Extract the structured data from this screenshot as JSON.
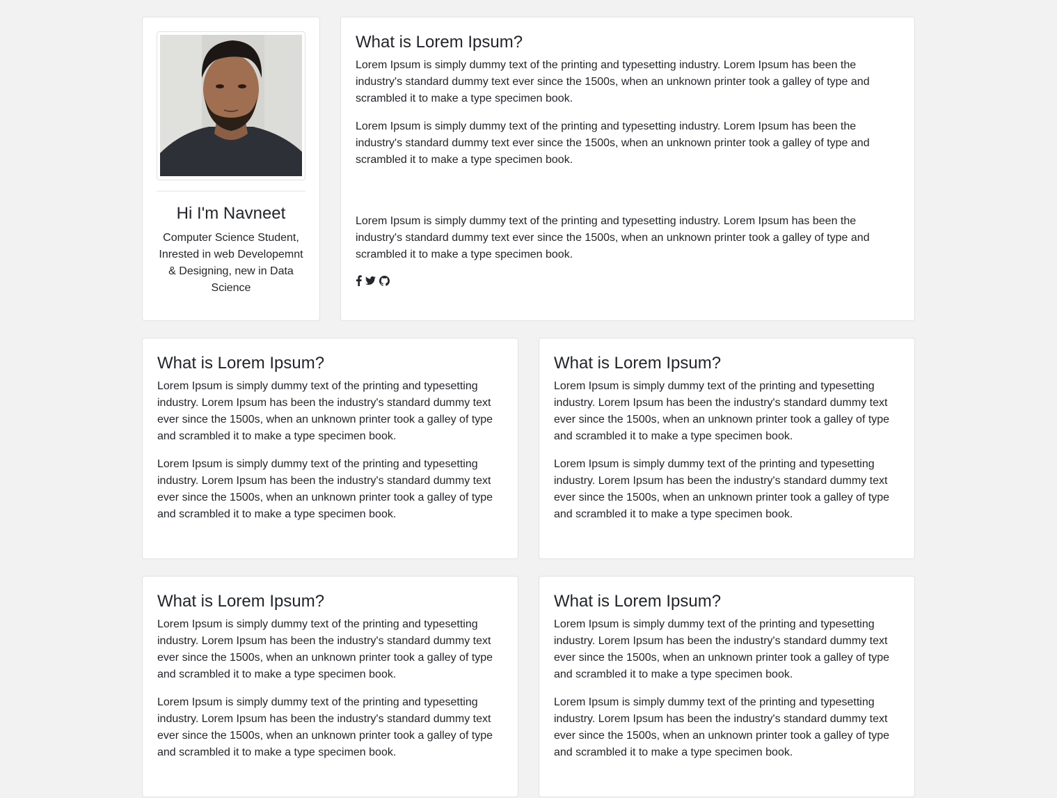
{
  "profile": {
    "name": "Hi I'm Navneet",
    "bio": "Computer Science Student, Inrested in web Developemnt & Designing, new in Data Science",
    "photo_alt": "profile photo"
  },
  "main": {
    "title": "What is Lorem Ipsum?",
    "paragraphs": [
      "Lorem Ipsum is simply dummy text of the printing and typesetting industry. Lorem Ipsum has been the industry's standard dummy text ever since the 1500s, when an unknown printer took a galley of type and scrambled it to make a type specimen book.",
      "Lorem Ipsum is simply dummy text of the printing and typesetting industry. Lorem Ipsum has been the industry's standard dummy text ever since the 1500s, when an unknown printer took a galley of type and scrambled it to make a type specimen book.",
      "Lorem Ipsum is simply dummy text of the printing and typesetting industry. Lorem Ipsum has been the industry's standard dummy text ever since the 1500s, when an unknown printer took a galley of type and scrambled it to make a type specimen book."
    ],
    "social_icons": [
      "facebook-icon",
      "twitter-icon",
      "github-icon"
    ]
  },
  "cards": [
    {
      "title": "What is Lorem Ipsum?",
      "paragraphs": [
        "Lorem Ipsum is simply dummy text of the printing and typesetting industry. Lorem Ipsum has been the industry's standard dummy text ever since the 1500s, when an unknown printer took a galley of type and scrambled it to make a type specimen book.",
        "Lorem Ipsum is simply dummy text of the printing and typesetting industry. Lorem Ipsum has been the industry's standard dummy text ever since the 1500s, when an unknown printer took a galley of type and scrambled it to make a type specimen book."
      ]
    },
    {
      "title": "What is Lorem Ipsum?",
      "paragraphs": [
        "Lorem Ipsum is simply dummy text of the printing and typesetting industry. Lorem Ipsum has been the industry's standard dummy text ever since the 1500s, when an unknown printer took a galley of type and scrambled it to make a type specimen book.",
        "Lorem Ipsum is simply dummy text of the printing and typesetting industry. Lorem Ipsum has been the industry's standard dummy text ever since the 1500s, when an unknown printer took a galley of type and scrambled it to make a type specimen book."
      ]
    },
    {
      "title": "What is Lorem Ipsum?",
      "paragraphs": [
        "Lorem Ipsum is simply dummy text of the printing and typesetting industry. Lorem Ipsum has been the industry's standard dummy text ever since the 1500s, when an unknown printer took a galley of type and scrambled it to make a type specimen book.",
        "Lorem Ipsum is simply dummy text of the printing and typesetting industry. Lorem Ipsum has been the industry's standard dummy text ever since the 1500s, when an unknown printer took a galley of type and scrambled it to make a type specimen book."
      ]
    },
    {
      "title": "What is Lorem Ipsum?",
      "paragraphs": [
        "Lorem Ipsum is simply dummy text of the printing and typesetting industry. Lorem Ipsum has been the industry's standard dummy text ever since the 1500s, when an unknown printer took a galley of type and scrambled it to make a type specimen book.",
        "Lorem Ipsum is simply dummy text of the printing and typesetting industry. Lorem Ipsum has been the industry's standard dummy text ever since the 1500s, when an unknown printer took a galley of type and scrambled it to make a type specimen book."
      ]
    }
  ],
  "colors": {
    "page_background": "#f2f2f2",
    "card_background": "#ffffff",
    "text": "#212529"
  }
}
